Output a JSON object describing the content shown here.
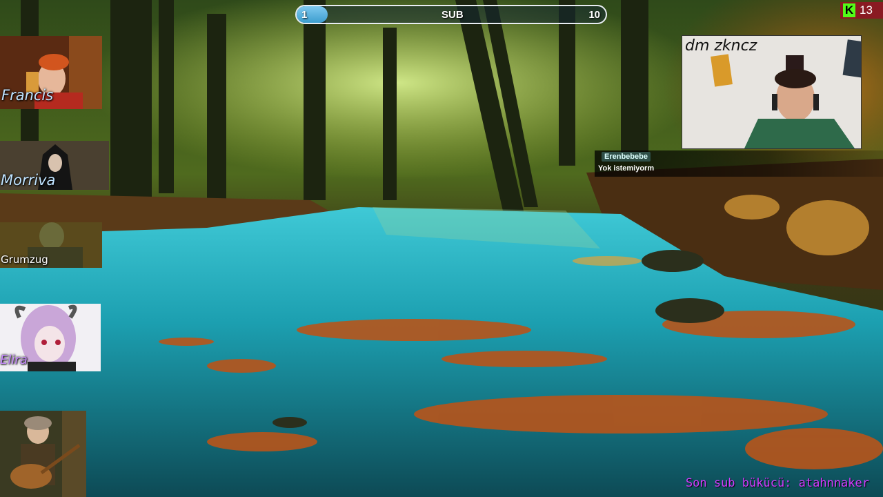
{
  "progress": {
    "current": "1",
    "label": "SUB",
    "goal": "10",
    "fraction": 0.1
  },
  "kick": {
    "count": "13",
    "logo": "K"
  },
  "webcam": {
    "label": "dm zkncz"
  },
  "portraits": [
    {
      "name": "Francis"
    },
    {
      "name": "Morriva"
    },
    {
      "name": "Grumzug"
    },
    {
      "name": "Elira"
    },
    {
      "name": ""
    }
  ],
  "chat": {
    "username": "Erenbebebe",
    "message": "Yok istemiyorm"
  },
  "footer": {
    "last_sub": "Son sub bükücü: atahnnaker"
  },
  "colors": {
    "progress_fill": "#4faede",
    "kick_brand": "#53fc18",
    "sub_text": "#d23cff"
  }
}
